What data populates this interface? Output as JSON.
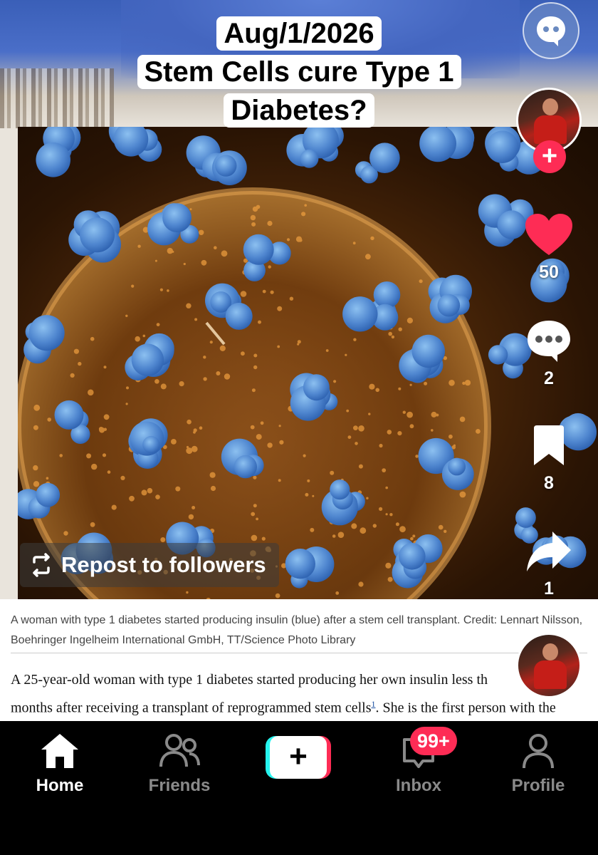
{
  "video": {
    "title_line1": "Aug/1/2026",
    "title_line2": "Stem Cells cure Type 1",
    "title_line3": "Diabetes?",
    "caption": "A woman with type 1 diabetes started producing insulin (blue) after a stem cell transplant.  Credit: Lennart Nilsson, Boehringer Ingelheim International GmbH, TT/Science Photo Library",
    "article_line1": "A 25-year-old woman with type 1 diabetes started producing her own insulin less th",
    "article_line2_a": "months after receiving a transplant of reprogrammed stem cells",
    "article_ref": "1",
    "article_line2_b": ". She is the first person with the"
  },
  "actions": {
    "likes": "50",
    "comments": "2",
    "saves": "8",
    "shares": "1",
    "repost_label": "Repost to followers"
  },
  "icons": {
    "messenger": "chat-bubble-icon",
    "like": "heart-icon",
    "comment": "comment-dots-icon",
    "save": "bookmark-icon",
    "share": "share-arrow-icon",
    "repost": "repost-icon"
  },
  "nav": {
    "home": "Home",
    "friends": "Friends",
    "create": "+",
    "inbox": "Inbox",
    "inbox_badge": "99+",
    "profile": "Profile"
  },
  "colors": {
    "accent": "#fe2c55",
    "create_cyan": "#25f4ee",
    "nav_bg": "#000000",
    "insulin_blue": "#5a94d8"
  }
}
